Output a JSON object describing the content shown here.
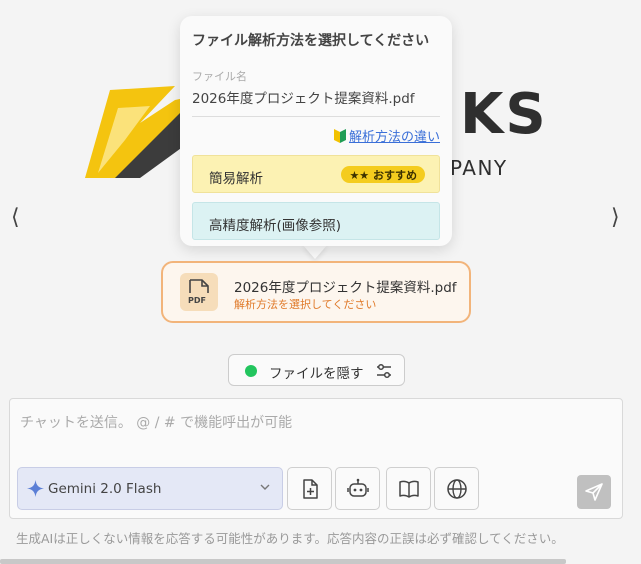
{
  "logo": {
    "text": "KS",
    "subtitle": "PANY"
  },
  "nav": {
    "prev_glyph": "⟨",
    "next_glyph": "⟩"
  },
  "popover": {
    "title": "ファイル解析方法を選択してください",
    "filename_label": "ファイル名",
    "filename": "2026年度プロジェクト提案資料.pdf",
    "help_link": "解析方法の違い",
    "options": [
      {
        "label": "簡易解析",
        "badge": "おすすめ",
        "recommended": true
      },
      {
        "label": "高精度解析(画像参照)",
        "recommended": false
      }
    ]
  },
  "file_chip": {
    "icon": "pdf-file-icon",
    "name": "2026年度プロジェクト提案資料.pdf",
    "status": "解析方法を選択してください"
  },
  "hide_files": {
    "label": "ファイルを隠す",
    "status_color": "#22c55e"
  },
  "chat": {
    "placeholder": "チャットを送信。 @ / # で機能呼出が可能",
    "value": "",
    "model": "Gemini 2.0 Flash",
    "tools": [
      "add-file-icon",
      "robot-icon",
      "book-icon",
      "globe-icon"
    ],
    "send_icon": "send-icon"
  },
  "disclaimer": "生成AIは正しくない情報を応答する可能性があります。応答内容の正誤は必ず確認してください。",
  "colors": {
    "accent_orange": "#f2b47a",
    "simple_option_bg": "#fcf2b3",
    "precise_option_bg": "#dcf2f3",
    "badge_yellow": "#f4cc1e",
    "link_blue": "#3a6fd8",
    "model_select_bg": "#e4e8f6"
  }
}
